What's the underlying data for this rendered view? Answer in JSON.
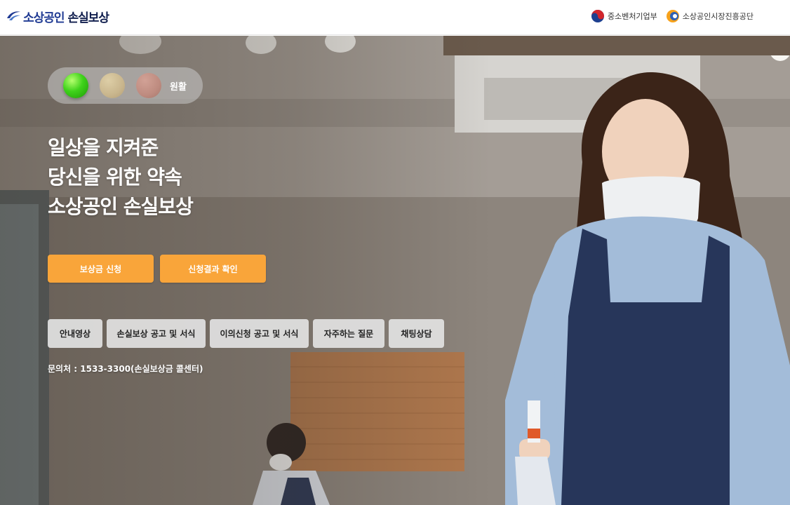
{
  "header": {
    "logo": {
      "part1": "소상공인",
      "part2": "손실보상"
    },
    "orgs": [
      {
        "label": "중소벤처기업부",
        "icon": "taegeuk-emblem-icon"
      },
      {
        "label": "소상공인시장진흥공단",
        "icon": "semas-emblem-icon"
      }
    ]
  },
  "status": {
    "label": "원활",
    "lights": [
      "green",
      "yellow",
      "red"
    ],
    "active_light": "green"
  },
  "hero": {
    "headline": [
      "일상을 지켜준",
      "당신을 위한 약속",
      "소상공인 손실보상"
    ]
  },
  "primary_buttons": [
    "보상금 신청",
    "신청결과 확인"
  ],
  "secondary_buttons": [
    "안내영상",
    "손실보상 공고 및 서식",
    "이의신청 공고 및 서식",
    "자주하는 질문",
    "채팅상담"
  ],
  "contact": "문의처 : 1533-3300(손실보상금 콜센터)",
  "colors": {
    "brand_blue": "#1f3a93",
    "primary_button": "#f9a53a",
    "secondary_button": "#e2e2e2",
    "status_green": "#3fd21b"
  }
}
